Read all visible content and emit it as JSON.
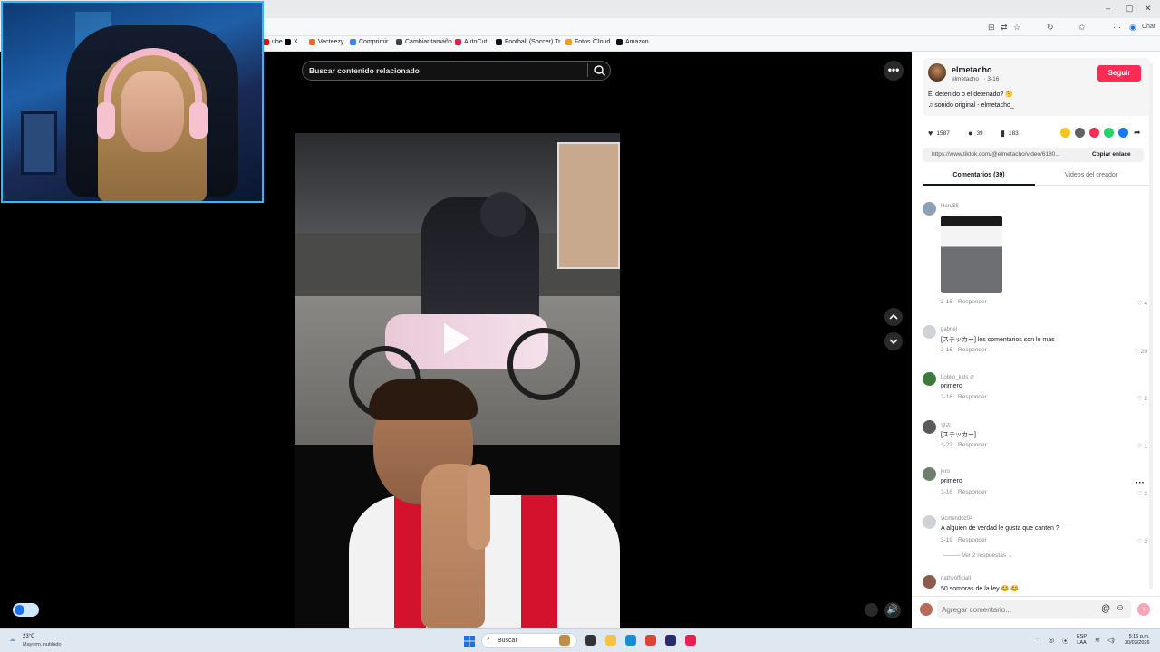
{
  "browser": {
    "bookmarks": [
      {
        "label": "ube",
        "color": "#ff0000"
      },
      {
        "label": "X",
        "color": "#000000"
      },
      {
        "label": "Vecteezy",
        "color": "#f26522"
      },
      {
        "label": "Comprimir",
        "color": "#3b82f6"
      },
      {
        "label": "Cambiar tamaño",
        "color": "#444444"
      },
      {
        "label": "AutoCut",
        "color": "#e11d48"
      },
      {
        "label": "Football (Soccer) Tr...",
        "color": "#111111"
      },
      {
        "label": "Fotos iCloud",
        "color": "#f59e0b"
      },
      {
        "label": "Amazon",
        "color": "#111111"
      }
    ],
    "chat_label": "Chat"
  },
  "player": {
    "search_placeholder": "Buscar contenido relacionado",
    "more_label": "•••",
    "volume_icon": "🔊"
  },
  "video": {
    "author": "elmetacho",
    "handle_line": "elmetacho_ · 3-16",
    "follow_label": "Seguir",
    "caption": "El detenido o el detenado? 🤔",
    "sound": "sonido original - elmetacho_",
    "likes": "1587",
    "comments_count": "39",
    "saves": "183",
    "link": "https://www.tiktok.com/@elmetacho/video/6180...",
    "copy_label": "Copiar enlace",
    "share_colors": [
      "#f5c518",
      "#5f6368",
      "#fe2c55",
      "#25d366",
      "#1877f2"
    ]
  },
  "tabs": {
    "comments": "Comentarios (39)",
    "videos": "Videos del creador"
  },
  "comments": [
    {
      "user": "Haru$$",
      "text": "",
      "date": "3-16",
      "reply": "Responder",
      "likes": "4"
    },
    {
      "user": "gabriel",
      "text": "[ステッカー] los comentarios son lo mas",
      "date": "3-16",
      "reply": "Responder",
      "likes": "20"
    },
    {
      "user": "Lobito_kids ⊘",
      "text": "primero",
      "date": "3-16",
      "reply": "Responder",
      "likes": "2"
    },
    {
      "user": "영리",
      "text": "[ステッカー]",
      "date": "3-22",
      "reply": "Responder",
      "likes": "1"
    },
    {
      "user": "jero",
      "text": "primero",
      "date": "3-16",
      "reply": "Responder",
      "likes": "2"
    },
    {
      "user": "vicmendoz04",
      "text": "A alguien de verdad le gusta que canten ?",
      "date": "3-19",
      "reply": "Responder",
      "likes": "3"
    },
    {
      "user": "nathyofficiall",
      "text": "50 sombras de la ley 😂 😂",
      "date": "",
      "reply": "",
      "likes": ""
    }
  ],
  "replies_label": "Ver 2 respuestas ⌄",
  "comment_input_placeholder": "Agregar comentario...",
  "taskbar": {
    "temp": "23°C",
    "weather": "Mayorm. nublado",
    "search": "Buscar",
    "lang_line1": "ESP",
    "lang_line2": "LAA",
    "time": "5:16 p.m.",
    "date": "30/03/2026"
  }
}
